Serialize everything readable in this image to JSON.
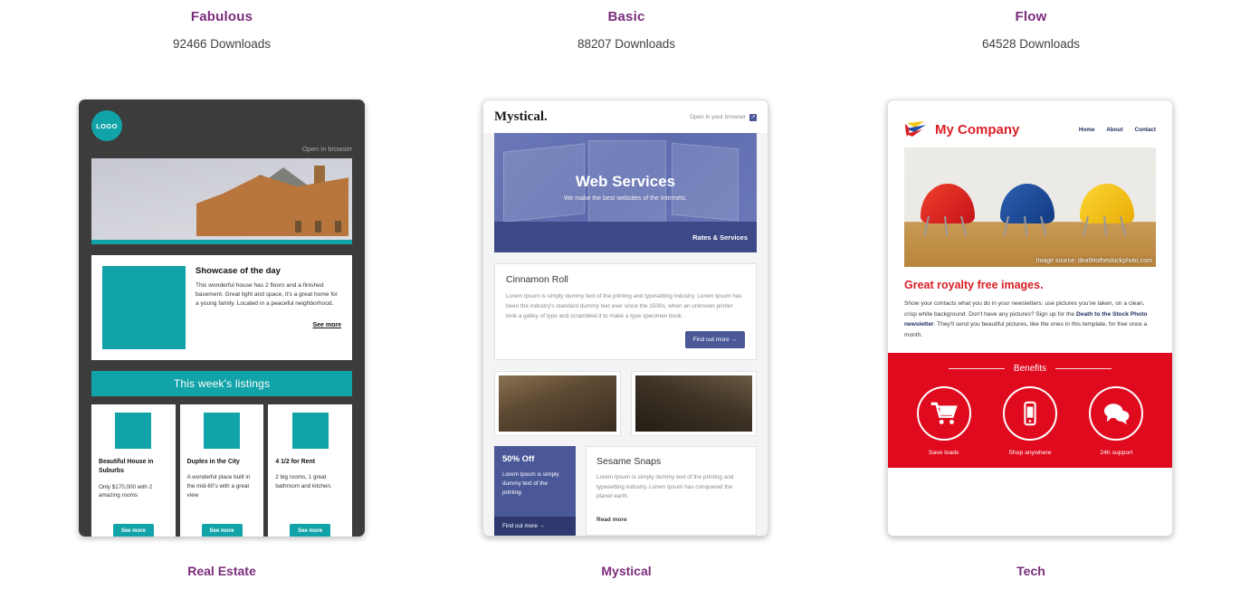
{
  "columns": [
    {
      "title": "Fabulous",
      "downloads": "92466 Downloads",
      "footer": "Real Estate"
    },
    {
      "title": "Basic",
      "downloads": "88207 Downloads",
      "footer": "Mystical"
    },
    {
      "title": "Flow",
      "downloads": "64528 Downloads",
      "footer": "Tech"
    }
  ],
  "colors": {
    "title_purple": "#7b2d7b",
    "teal": "#12a3a8",
    "card1_bg": "#3c3c3c",
    "mystical_blue": "#4a5898",
    "mystical_dark": "#3d4886",
    "tech_red": "#e00a1e",
    "tech_logo_red": "#d81f26",
    "tech_navy": "#1d2a5e"
  },
  "card1": {
    "logo": "LOGO",
    "open_in_browser": "Open in browser",
    "showcase": {
      "heading": "Showcase of the day",
      "body": "This wonderful house has 2 floors and a finished basement. Great light and space, it's a great home for a young family. Located in a peaceful neighborhood.",
      "link": "See more"
    },
    "banner": "This week's listings",
    "listings": [
      {
        "title": "Beautiful House in Suburbs",
        "desc": "Only $170,000 with 2 amazing rooms",
        "button": "See more"
      },
      {
        "title": "Duplex in the City",
        "desc": "A wonderful place built in the mid-60's with a great view",
        "button": "See more"
      },
      {
        "title": "4 1/2 for Rent",
        "desc": "2 big rooms, 1 great bathroom and kitchen.",
        "button": "See more"
      }
    ]
  },
  "card2": {
    "logo": "Mystical.",
    "open_in_browser": "Open in your browser",
    "hero": {
      "title": "Web Services",
      "subtitle": "We make the best websites of the Internets.",
      "bar_link": "Rates & Services"
    },
    "article": {
      "title": "Cinnamon Roll",
      "body": "Lorem Ipsum is simply dummy text of the printing and typesetting industry. Lorem Ipsum has been the industry's standard dummy text ever since the 1500s, when an unknown printer took a galley of type and scrambled it to make a type specimen book.",
      "button": "Find out more →"
    },
    "promo": {
      "title": "50% Off",
      "body": "Lorem Ipsum is simply dummy text of the printing.",
      "link": "Find out more →"
    },
    "secondary": {
      "title": "Sesame Snaps",
      "body": "Lorem Ipsum is simply dummy text of the printing and typesetting industry. Lorem Ipsum has conquered the planet earth.",
      "link": "Read more"
    }
  },
  "card3": {
    "company": "My Company",
    "nav": [
      "Home",
      "About",
      "Contact"
    ],
    "photo_credit": "Image source: deathtothestockphoto.com",
    "headline": "Great royalty free images.",
    "body_1": "Show your contacts what you do in your newsletters: use pictures you've taken, on a clean, crisp white background. Don't have any pictures? Sign up for the ",
    "body_bold": "Death to the Stock Photo newsletter",
    "body_2": ". They'll send you beautiful pictures, like the ones in this template, for free once a month.",
    "benefits_title": "Benefits",
    "benefits": [
      {
        "icon": "shopping-cart-icon",
        "label": "Save loads"
      },
      {
        "icon": "mobile-phone-icon",
        "label": "Shop anywhere"
      },
      {
        "icon": "speech-bubbles-icon",
        "label": "24h support"
      }
    ]
  }
}
